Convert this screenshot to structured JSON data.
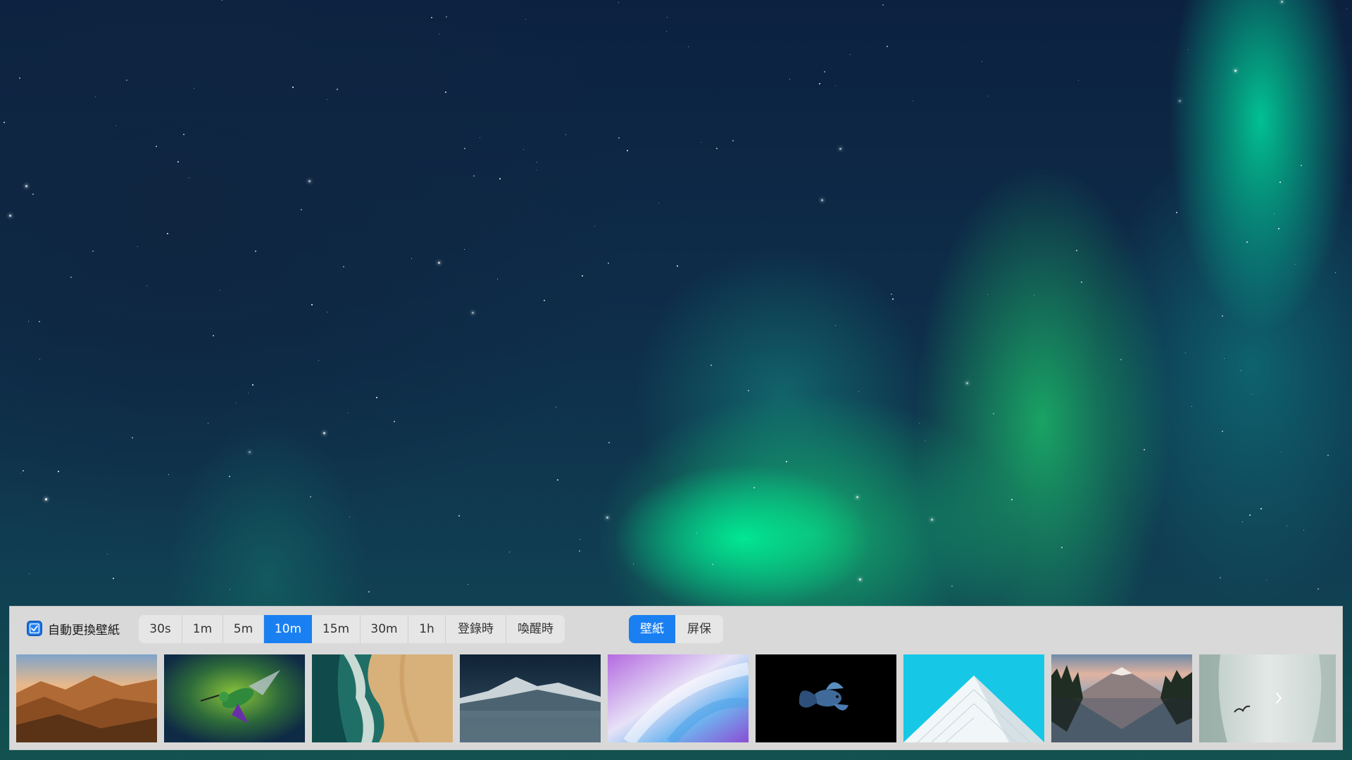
{
  "auto_change": {
    "label": "自動更換壁紙",
    "checked": true
  },
  "intervals": {
    "options": [
      "30s",
      "1m",
      "5m",
      "10m",
      "15m",
      "30m",
      "1h",
      "登錄時",
      "喚醒時"
    ],
    "selected": "10m"
  },
  "mode": {
    "options": [
      "壁紙",
      "屏保"
    ],
    "selected": "壁紙"
  },
  "thumbnails": [
    {
      "name": "mountain-sunset-thumbnail"
    },
    {
      "name": "hummingbird-thumbnail"
    },
    {
      "name": "aerial-beach-thumbnail"
    },
    {
      "name": "snowy-peak-clouds-thumbnail"
    },
    {
      "name": "abstract-gradient-thumbnail"
    },
    {
      "name": "betta-fish-thumbnail"
    },
    {
      "name": "white-building-thumbnail"
    },
    {
      "name": "lake-reflection-thumbnail"
    },
    {
      "name": "foggy-cliff-bird-thumbnail"
    }
  ],
  "icons": {
    "checkbox": "check-icon",
    "next": "chevron-right-icon"
  },
  "colors": {
    "accent": "#1a80f2",
    "panel_bg": "#d9d9d9"
  }
}
